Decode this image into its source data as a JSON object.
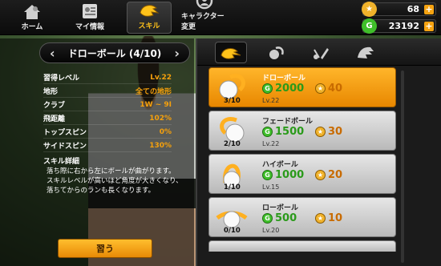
{
  "nav": {
    "tabs": [
      {
        "label": "ホーム",
        "icon": "home-icon"
      },
      {
        "label": "マイ情報",
        "icon": "profile-card-icon"
      },
      {
        "label": "スキル",
        "icon": "skill-icon",
        "active": true
      },
      {
        "label": "キャラクター変更",
        "icon": "character-change-icon"
      }
    ]
  },
  "currency": {
    "stars": "68",
    "gold": "23192"
  },
  "skill_detail": {
    "title": "ドローボール (4/10)",
    "stats": [
      {
        "label": "習得レベル",
        "value": "Lv.22"
      },
      {
        "label": "地形",
        "value": "全ての地形"
      },
      {
        "label": "クラブ",
        "value": "1W ~ 9I"
      },
      {
        "label": "飛距離",
        "value": "102%"
      },
      {
        "label": "トップスピン",
        "value": "0%"
      },
      {
        "label": "サイドスピン",
        "value": "130%"
      }
    ],
    "detail_title": "スキル詳細",
    "description": [
      "落ち際に右から左にボールが曲がります。",
      "スキルレベルが高いほど角度が大きくなり、",
      "落ちてからのランも長くなります。"
    ],
    "learn_button": "習う"
  },
  "skills": [
    {
      "name": "ドローボール",
      "gold": "2000",
      "stars": "40",
      "req": "Lv.22",
      "level": "3/10",
      "selected": true
    },
    {
      "name": "フェードボール",
      "gold": "1500",
      "stars": "30",
      "req": "Lv.22",
      "level": "2/10",
      "selected": false
    },
    {
      "name": "ハイボール",
      "gold": "1000",
      "stars": "20",
      "req": "Lv.15",
      "level": "1/10",
      "selected": false
    },
    {
      "name": "ローボール",
      "gold": "500",
      "stars": "10",
      "req": "Lv.20",
      "level": "0/10",
      "selected": false
    }
  ],
  "colors": {
    "accent": "#f5a311",
    "selected_card": "#ffb52a",
    "gold_coin": "#3fbf2a",
    "star_coin": "#f0b22b"
  }
}
